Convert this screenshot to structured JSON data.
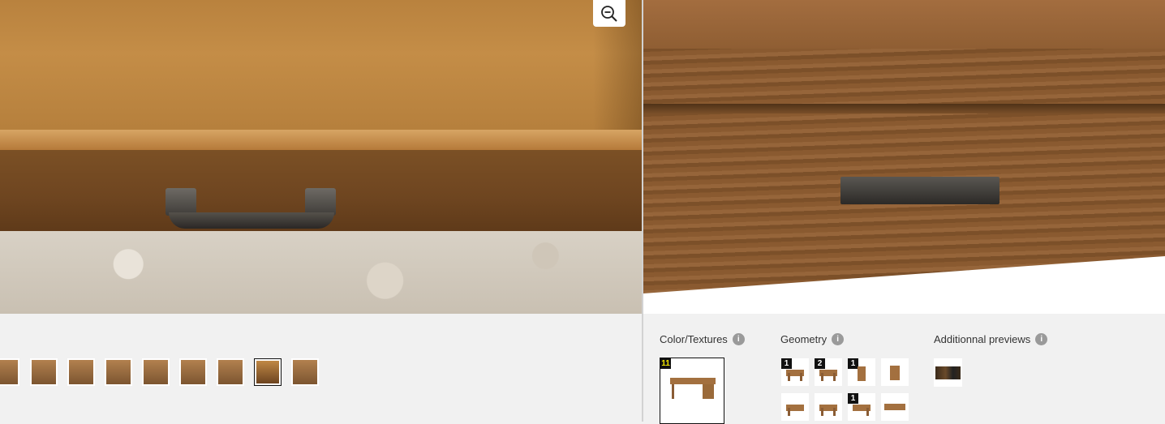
{
  "viewer": {
    "zoom_button_icon": "zoom-out-icon"
  },
  "thumbnails": {
    "count": 9,
    "selected_index": 7
  },
  "panel": {
    "sections": [
      {
        "title": "Color/Textures",
        "info_icon": "info-icon"
      },
      {
        "title": "Geometry",
        "info_icon": "info-icon"
      },
      {
        "title": "Additionnal previews",
        "info_icon": "info-icon"
      }
    ],
    "color_textures": {
      "selected_badge": "11"
    },
    "geometry": {
      "items": [
        {
          "badge": "1"
        },
        {
          "badge": "2"
        },
        {
          "badge": "1"
        },
        {
          "badge": ""
        },
        {
          "badge": ""
        },
        {
          "badge": ""
        },
        {
          "badge": "1"
        },
        {
          "badge": ""
        }
      ]
    },
    "additional_previews": {
      "items": [
        {
          "badge": ""
        }
      ]
    }
  },
  "colors": {
    "badge_bg": "#111111",
    "badge_accent": "#f2e600",
    "panel_bg": "#f1f1f1",
    "info_icon": "#9a9a9a"
  }
}
